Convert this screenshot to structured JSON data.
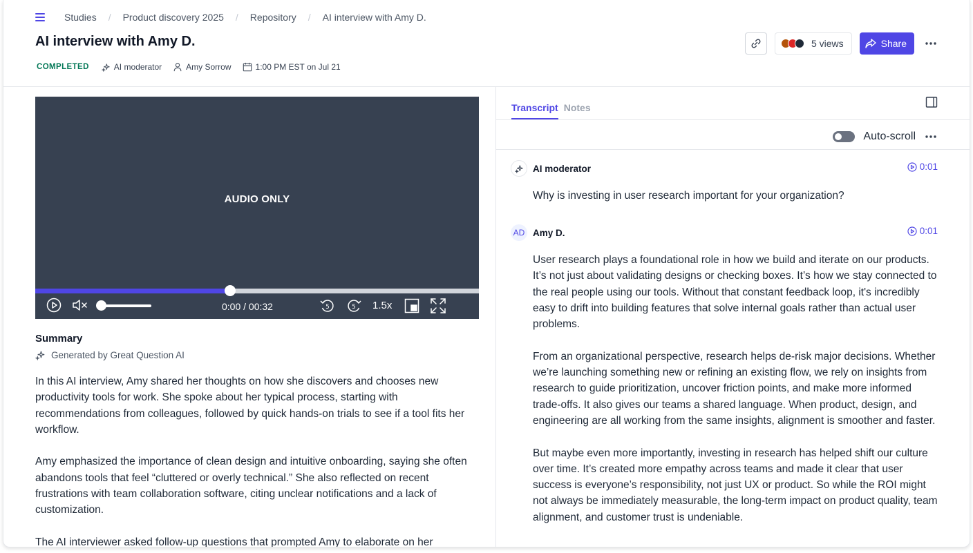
{
  "breadcrumbs": [
    "Studies",
    "Product discovery 2025",
    "Repository",
    "AI interview with Amy D."
  ],
  "page_title": "AI interview with Amy D.",
  "meta": {
    "status": "COMPLETED",
    "moderator": "AI moderator",
    "participant": "Amy Sorrow",
    "datetime": "1:00 PM EST on Jul 21"
  },
  "actions": {
    "views_label": "5 views",
    "share_label": "Share"
  },
  "player": {
    "label": "AUDIO ONLY",
    "time": "0:00 / 00:32",
    "speed": "1.5x",
    "progress_fraction": 0.44,
    "volume_fraction": 0.05
  },
  "summary": {
    "title": "Summary",
    "generated_by": "Generated by Great Question AI",
    "paragraphs": [
      "In this AI interview, Amy shared her thoughts on how she discovers and chooses new productivity tools for work. She spoke about her typical process, starting with recommendations from colleagues, followed by quick hands-on trials to see if a tool fits her workflow.",
      "Amy emphasized the importance of clean design and intuitive onboarding, saying she often abandons tools that feel “cluttered or overly technical.” She also reflected on recent frustrations with team collaboration software, citing unclear notifications and a lack of customization.",
      "The AI interviewer asked follow-up questions that prompted Amy to elaborate on her"
    ]
  },
  "tabs": [
    "Transcript",
    "Notes"
  ],
  "autoscroll_label": "Auto-scroll",
  "transcript": [
    {
      "speaker": "AI moderator",
      "timestamp": "0:01",
      "paragraphs": [
        "Why is investing in user research important for your organization?"
      ]
    },
    {
      "speaker": "Amy D.",
      "initials": "AD",
      "timestamp": "0:01",
      "paragraphs": [
        "User research plays a foundational role in how we build and iterate on our products. It’s not just about validating designs or checking boxes. It’s how we stay connected to the real people using our tools. Without that constant feedback loop, it's incredibly easy to drift into building features that solve internal goals rather than actual user problems.",
        "From an organizational perspective, research helps de-risk major decisions. Whether we’re launching something new or refining an existing flow, we rely on insights from research to guide prioritization, uncover friction points, and make more informed trade-offs. It also gives our teams a shared language. When product, design, and engineering are all working from the same insights, alignment is smoother and faster.",
        "But maybe even more importantly, investing in research has helped shift our culture over time. It’s created more empathy across teams and made it clear that user success is everyone’s responsibility, not just UX or product. So while the ROI might not always be immediately measurable, the long-term impact on product quality, team alignment, and customer trust is undeniable."
      ]
    }
  ],
  "colors": {
    "accent": "#4f46e5",
    "status": "#047857",
    "player_bg": "#374151"
  }
}
